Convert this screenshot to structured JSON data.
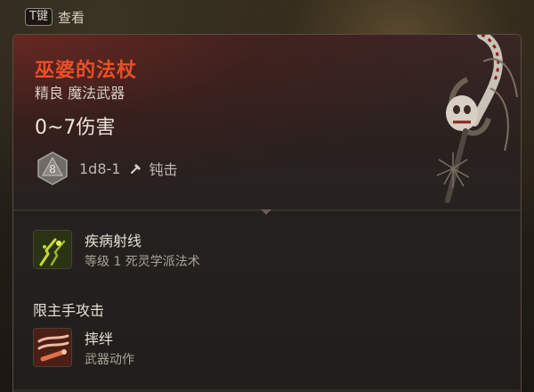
{
  "hint": {
    "key": "T键",
    "label": "查看"
  },
  "item": {
    "name": "巫婆的法杖",
    "subtitle": "精良 魔法武器",
    "damage": "0~7伤害",
    "dice_face": "8",
    "dice_text": "1d8-1",
    "damage_type": "钝击"
  },
  "abilities": [
    {
      "name": "疾病射线",
      "desc": "等级 1 死灵学派法术",
      "icon": "sickness-ray-icon"
    },
    {
      "name": "摔绊",
      "desc": "武器动作",
      "icon": "topple-icon"
    }
  ],
  "sections": {
    "main_hand": "限主手攻击"
  },
  "colors": {
    "title": "#e8502a",
    "text": "#e6dfd3",
    "muted": "#a9a296",
    "header_bg": "#3a2624"
  }
}
